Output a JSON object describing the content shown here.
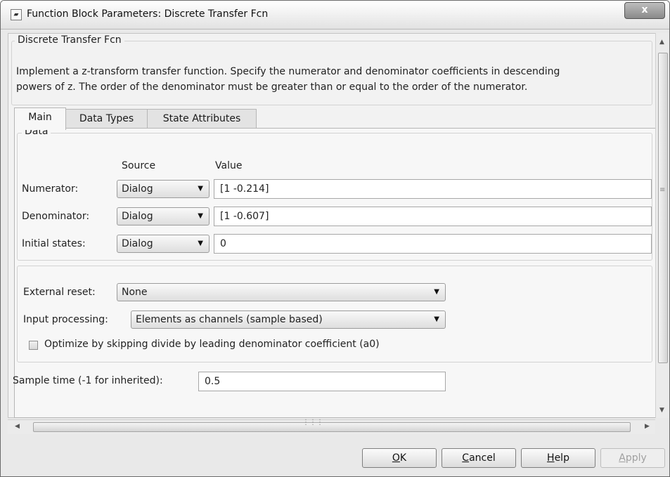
{
  "window": {
    "title": "Function Block Parameters: Discrete Transfer Fcn",
    "close_label": "x"
  },
  "block": {
    "name": "Discrete Transfer Fcn",
    "description_line1": "Implement a z-transform transfer function. Specify the numerator and denominator coefficients in descending",
    "description_line2": "powers of z. The order of the denominator must be greater than or equal to the order of the numerator."
  },
  "tabs": [
    {
      "label": "Main",
      "active": true
    },
    {
      "label": "Data Types",
      "active": false
    },
    {
      "label": "State Attributes",
      "active": false
    }
  ],
  "data_group": {
    "title": "Data",
    "source_header": "Source",
    "value_header": "Value",
    "rows": [
      {
        "label": "Numerator:",
        "source": "Dialog",
        "value": "[1 -0.214]"
      },
      {
        "label": "Denominator:",
        "source": "Dialog",
        "value": "[1 -0.607]"
      },
      {
        "label": "Initial states:",
        "source": "Dialog",
        "value": "0"
      }
    ]
  },
  "options": {
    "external_reset_label": "External reset:",
    "external_reset_value": "None",
    "input_processing_label": "Input processing:",
    "input_processing_value": "Elements as channels (sample based)",
    "optimize_label": "Optimize by skipping divide by leading denominator coefficient (a0)",
    "optimize_checked": false
  },
  "sample_time": {
    "label": "Sample time (-1 for inherited):",
    "value": "0.5"
  },
  "buttons": {
    "ok_pre": "",
    "ok_key": "O",
    "ok_post": "K",
    "cancel_pre": "",
    "cancel_key": "C",
    "cancel_post": "ancel",
    "help_pre": "",
    "help_key": "H",
    "help_post": "elp",
    "apply_pre": "",
    "apply_key": "A",
    "apply_post": "pply"
  }
}
